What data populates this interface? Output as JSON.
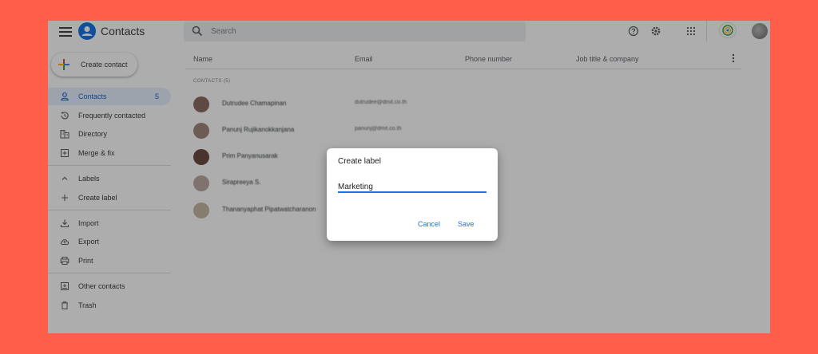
{
  "app": {
    "title": "Contacts"
  },
  "search": {
    "placeholder": "Search"
  },
  "sidebar": {
    "create_label": "Create contact",
    "items": [
      {
        "label": "Contacts",
        "count": "5",
        "icon": "person-icon",
        "active": true
      },
      {
        "label": "Frequently contacted",
        "icon": "history-icon"
      },
      {
        "label": "Directory",
        "icon": "domain-icon"
      },
      {
        "label": "Merge & fix",
        "icon": "merge-icon"
      }
    ],
    "labels_group": [
      {
        "label": "Labels",
        "icon": "chevron-up-icon"
      },
      {
        "label": "Create label",
        "icon": "plus-icon"
      }
    ],
    "tools": [
      {
        "label": "Import",
        "icon": "import-icon"
      },
      {
        "label": "Export",
        "icon": "cloud-upload-icon"
      },
      {
        "label": "Print",
        "icon": "print-icon"
      }
    ],
    "other": [
      {
        "label": "Other contacts",
        "icon": "other-contacts-icon"
      },
      {
        "label": "Trash",
        "icon": "trash-icon"
      }
    ]
  },
  "table": {
    "columns": [
      "Name",
      "Email",
      "Phone number",
      "Job title & company"
    ],
    "section_label": "CONTACTS (5)",
    "rows": [
      {
        "name": "Dutrudee Chamapinan",
        "email": "dutrudee@dmit.co.th",
        "avatar_color": "#8d6e63"
      },
      {
        "name": "Panunj Rujikanokkanjana",
        "email": "panunj@dmit.co.th",
        "avatar_color": "#a1887f"
      },
      {
        "name": "Prim Panyanusarak",
        "email": "",
        "avatar_color": "#6d4c41"
      },
      {
        "name": "Sirapreeya S.",
        "email": "",
        "avatar_color": "#bcaaa4"
      },
      {
        "name": "Thananyaphat Pipatwatcharanon",
        "email": "",
        "avatar_color": "#c5b8a5"
      }
    ]
  },
  "dialog": {
    "title": "Create label",
    "input_value": "Marketing",
    "cancel_label": "Cancel",
    "save_label": "Save"
  },
  "colors": {
    "accent": "#1a73e8",
    "background": "#ff5f4a"
  }
}
